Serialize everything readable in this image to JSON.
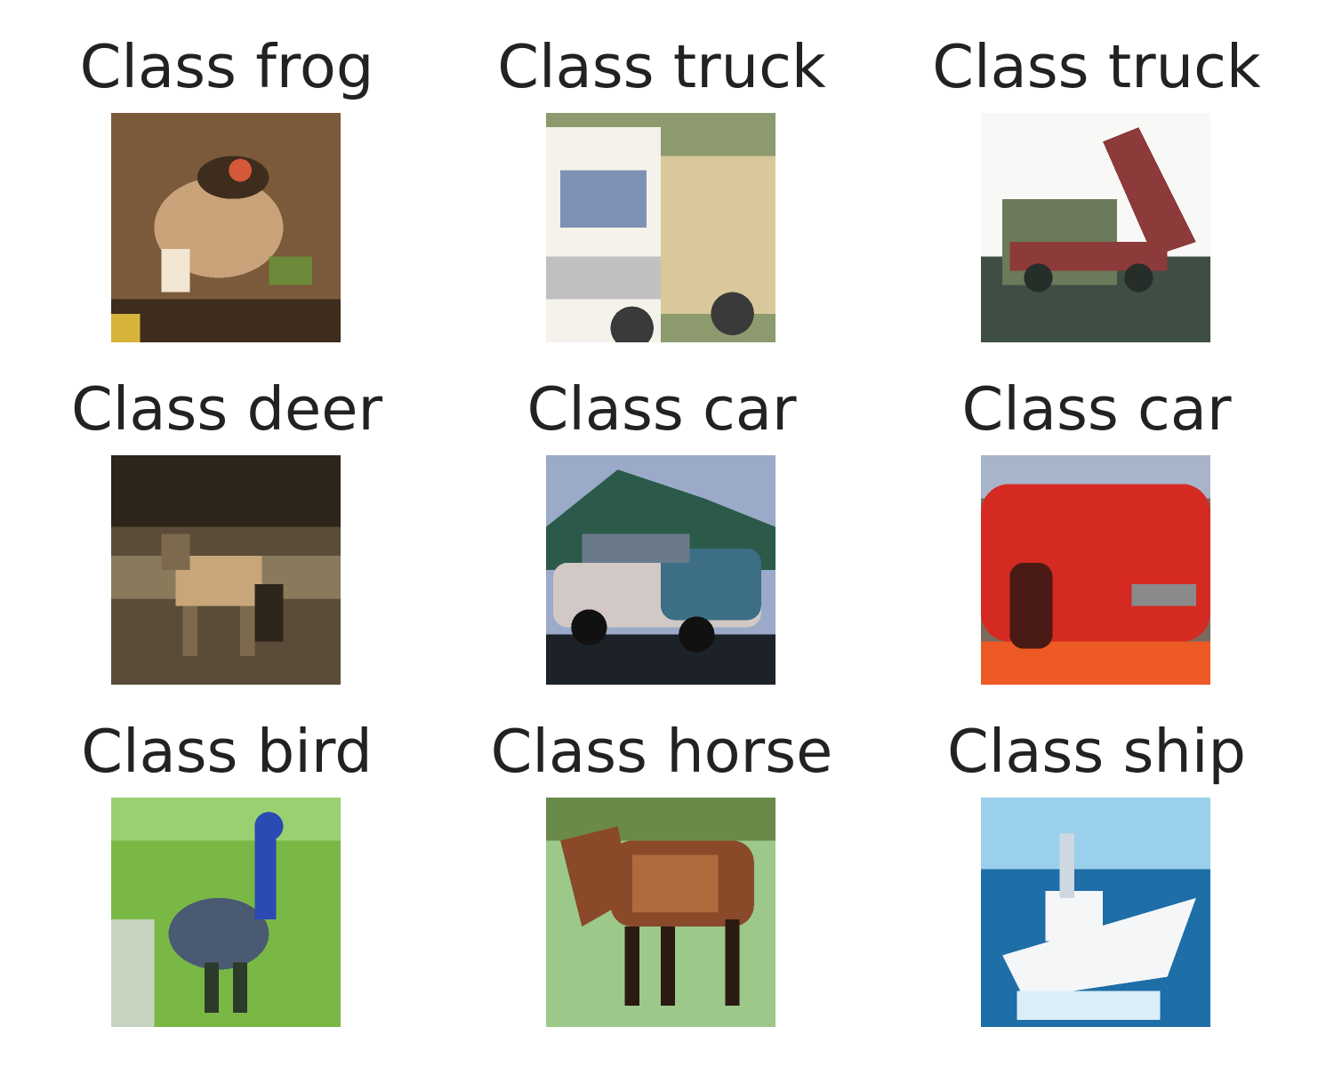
{
  "grid": [
    {
      "title": "Class frog",
      "icon": "frog-photo-thumbnail",
      "colors": {
        "bg": "#7a5a3a",
        "fg": "#c9a27a",
        "accent": "#d4583a",
        "dark": "#3e2c1c",
        "extra": "#6c8a3a"
      }
    },
    {
      "title": "Class truck",
      "icon": "truck-photo-thumbnail",
      "colors": {
        "bg": "#8c9a6e",
        "fg": "#f4f2ea",
        "accent": "#d9c89a",
        "dark": "#3a3a3a",
        "extra": "#7d91b4"
      }
    },
    {
      "title": "Class truck",
      "icon": "dump-truck-photo-thumbnail",
      "colors": {
        "bg": "#f8f8f6",
        "fg": "#3e4e44",
        "accent": "#8c3a3a",
        "dark": "#262e2a",
        "extra": "#6a7a5a"
      }
    },
    {
      "title": "Class deer",
      "icon": "deer-photo-thumbnail",
      "colors": {
        "bg": "#5a4c38",
        "fg": "#c8a67a",
        "accent": "#7d6a4e",
        "dark": "#2e261a",
        "extra": "#8a7a5c"
      }
    },
    {
      "title": "Class car",
      "icon": "car-photo-thumbnail",
      "colors": {
        "bg": "#9aaac8",
        "fg": "#d2c8c6",
        "accent": "#3c6e86",
        "dark": "#1c2228",
        "extra": "#2c5a4a"
      }
    },
    {
      "title": "Class car",
      "icon": "red-car-photo-thumbnail",
      "colors": {
        "bg": "#7a6a5c",
        "fg": "#d42a22",
        "accent": "#ee5a24",
        "dark": "#4a1a14",
        "extra": "#a8b4c8"
      }
    },
    {
      "title": "Class bird",
      "icon": "bird-photo-thumbnail",
      "colors": {
        "bg": "#7ab846",
        "fg": "#4a5a72",
        "accent": "#2a4ab4",
        "dark": "#2c3a2a",
        "extra": "#c8d4c0"
      }
    },
    {
      "title": "Class horse",
      "icon": "horse-photo-thumbnail",
      "colors": {
        "bg": "#9cc88a",
        "fg": "#8a4a2a",
        "accent": "#b06a3c",
        "dark": "#2a1a12",
        "extra": "#6a8a4a"
      }
    },
    {
      "title": "Class ship",
      "icon": "ship-photo-thumbnail",
      "colors": {
        "bg": "#6aa8d4",
        "fg": "#f4f6f8",
        "accent": "#1e6ea8",
        "dark": "#2a3a4a",
        "extra": "#9ad0ec"
      }
    }
  ]
}
